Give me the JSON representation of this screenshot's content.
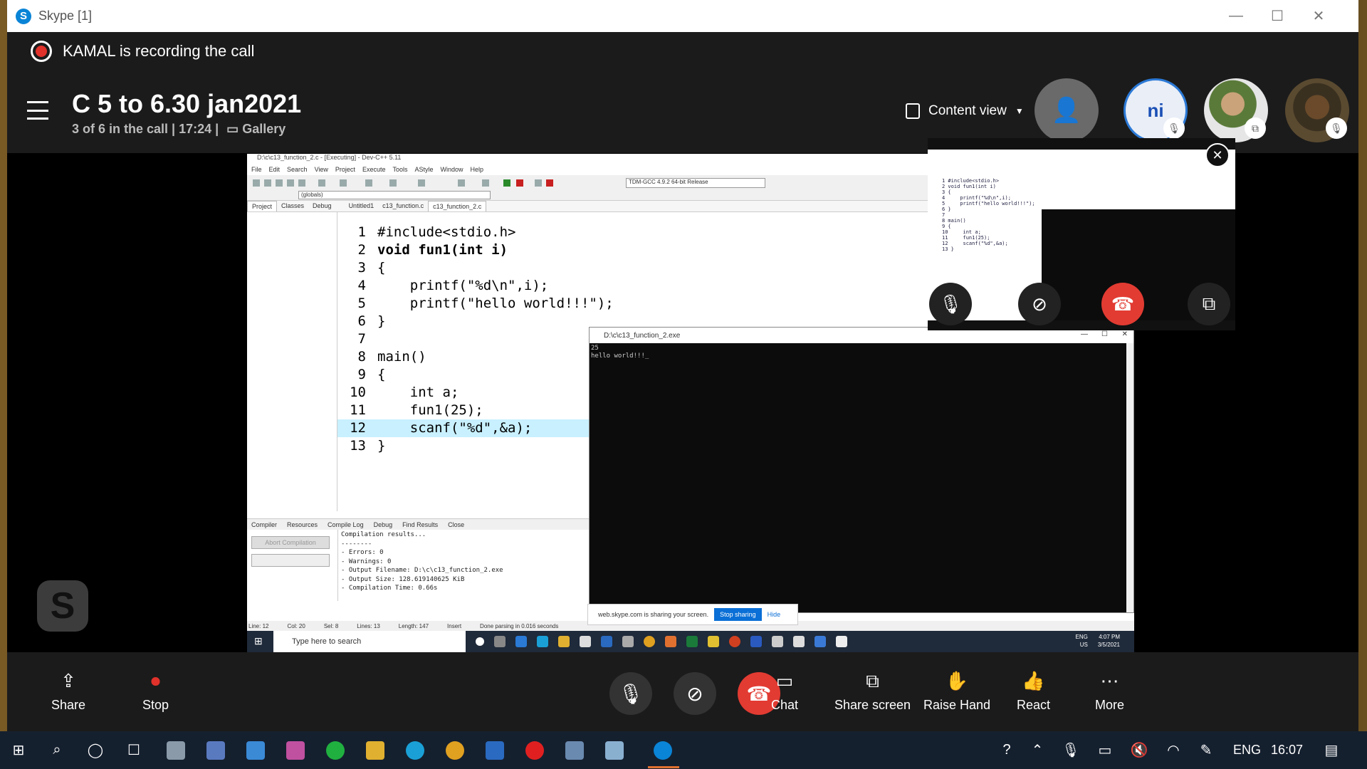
{
  "window": {
    "title": "Skype [1]",
    "minimize": "—",
    "maximize": "☐",
    "close": "✕"
  },
  "recording": {
    "text": "KAMAL is recording the call"
  },
  "call": {
    "title": "C 5 to 6.30 jan2021",
    "status": "3 of 6 in the call | 17:24 |",
    "gallery_label": "Gallery",
    "content_view_label": "Content view",
    "participants": {
      "ni_initials": "ni"
    }
  },
  "devcpp": {
    "title": "D:\\c\\c13_function_2.c - [Executing] - Dev-C++ 5.11",
    "menu": [
      "File",
      "Edit",
      "Search",
      "View",
      "Project",
      "Execute",
      "Tools",
      "AStyle",
      "Window",
      "Help"
    ],
    "compiler": "TDM-GCC 4.9.2 64-bit Release",
    "globals": "(globals)",
    "left_tabs": [
      "Project",
      "Classes",
      "Debug"
    ],
    "file_tabs": [
      "Untitled1",
      "c13_function.c",
      "c13_function_2.c"
    ],
    "code": [
      "#include<stdio.h>",
      "void fun1(int i)",
      "{",
      "    printf(\"%d\\n\",i);",
      "    printf(\"hello world!!!\");",
      "}",
      "",
      "main()",
      "{",
      "    int a;",
      "    fun1(25);",
      "    scanf(\"%d\",&a);",
      "}"
    ],
    "bottom_tabs": [
      "Compiler",
      "Resources",
      "Compile Log",
      "Debug",
      "Find Results",
      "Close"
    ],
    "abort_label": "Abort Compilation",
    "compile_log": [
      "Compilation results...",
      "--------",
      "- Errors: 0",
      "- Warnings: 0",
      "- Output Filename: D:\\c\\c13_function_2.exe",
      "- Output Size: 128.619140625 KiB",
      "- Compilation Time: 0.66s"
    ],
    "status": {
      "line": "Line:   12",
      "col": "Col:   20",
      "sel": "Sel:   8",
      "lines": "Lines:   13",
      "length": "Length:   147",
      "mode": "Insert",
      "parse": "Done parsing in 0.016 seconds"
    }
  },
  "console": {
    "title": "D:\\c\\c13_function_2.exe",
    "output": [
      "25",
      "hello world!!!_"
    ]
  },
  "sharebar": {
    "text": "web.skype.com is sharing your screen.",
    "stop_label": "Stop sharing",
    "hide_label": "Hide"
  },
  "inner_taskbar": {
    "search_placeholder": "Type here to search",
    "lang": "ENG",
    "region": "US",
    "time": "4:07 PM",
    "date": "3/5/2021"
  },
  "controls": {
    "share": "Share",
    "stop": "Stop",
    "chat": "Chat",
    "share_screen": "Share screen",
    "raise_hand": "Raise Hand",
    "react": "React",
    "more": "More"
  },
  "taskbar": {
    "lang": "ENG",
    "time": "16:07"
  },
  "colors": {
    "accent": "#0a84d6",
    "end_call": "#e23b32",
    "record": "#e0322b"
  }
}
